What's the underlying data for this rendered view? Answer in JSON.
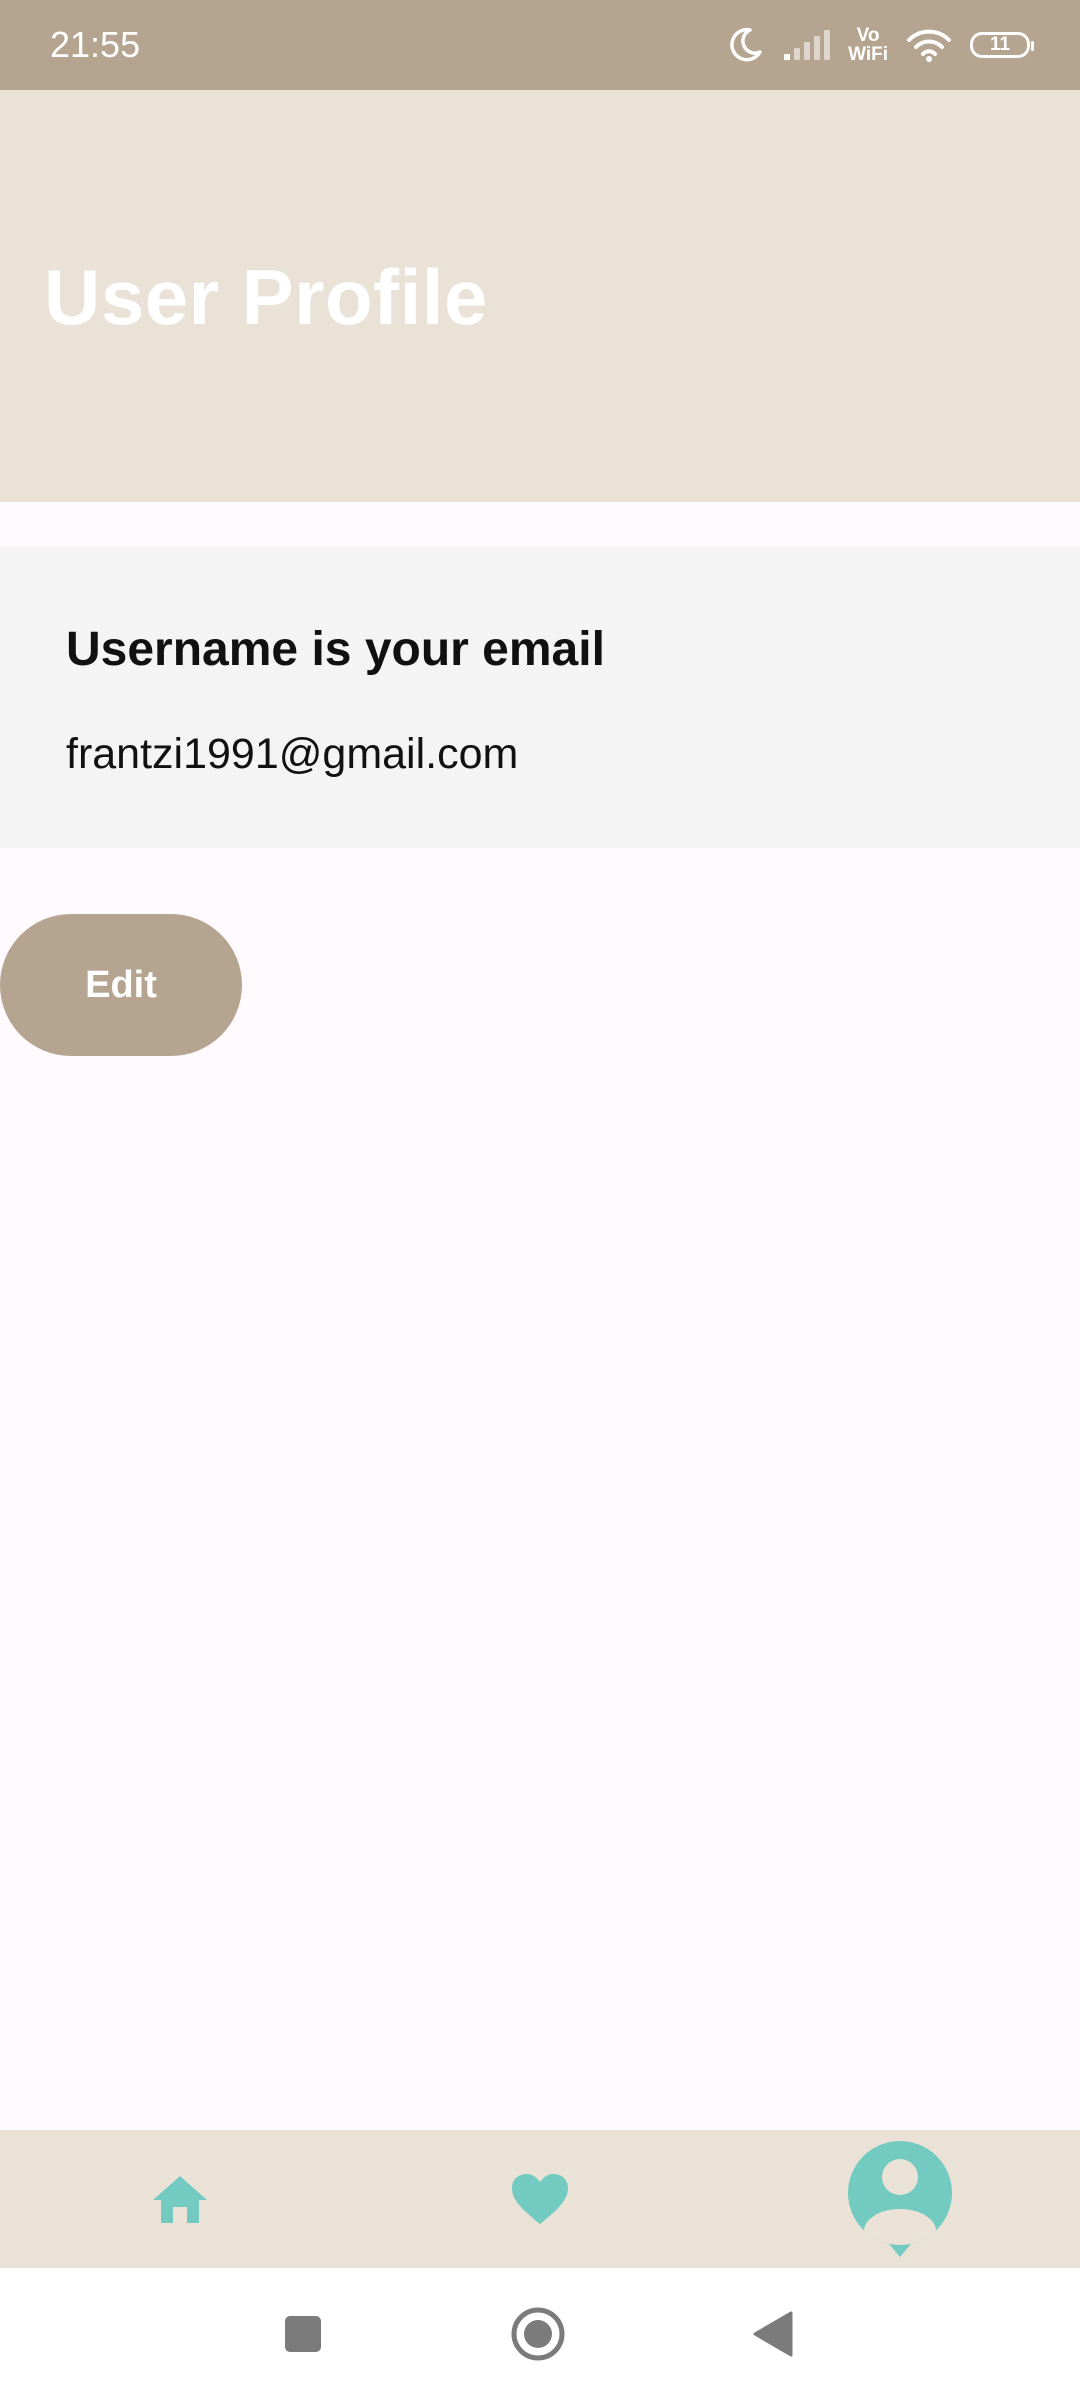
{
  "status_bar": {
    "time": "21:55",
    "vowifi_top": "Vo",
    "vowifi_bottom": "WiFi",
    "battery_level": "11",
    "icons": [
      "moon-icon",
      "signal-icon",
      "wifi-icon",
      "battery-icon"
    ]
  },
  "header": {
    "title": "User Profile"
  },
  "profile_card": {
    "heading": "Username is your email",
    "email": "frantzi1991@gmail.com"
  },
  "actions": {
    "edit_label": "Edit"
  },
  "bottom_nav": {
    "items": [
      {
        "icon": "home-icon"
      },
      {
        "icon": "heart-icon"
      },
      {
        "icon": "profile-icon",
        "active": true
      }
    ]
  },
  "system_nav": {
    "icons": [
      "recents-icon",
      "home-circle-icon",
      "back-icon"
    ]
  },
  "colors": {
    "status_bar": "#B5A590",
    "header_bg": "#EAE2D6",
    "accent_teal": "#72CAC0",
    "button_bg": "#B5A590",
    "card_bg": "#F4F4F4",
    "page_bg": "#FFFAFD"
  }
}
